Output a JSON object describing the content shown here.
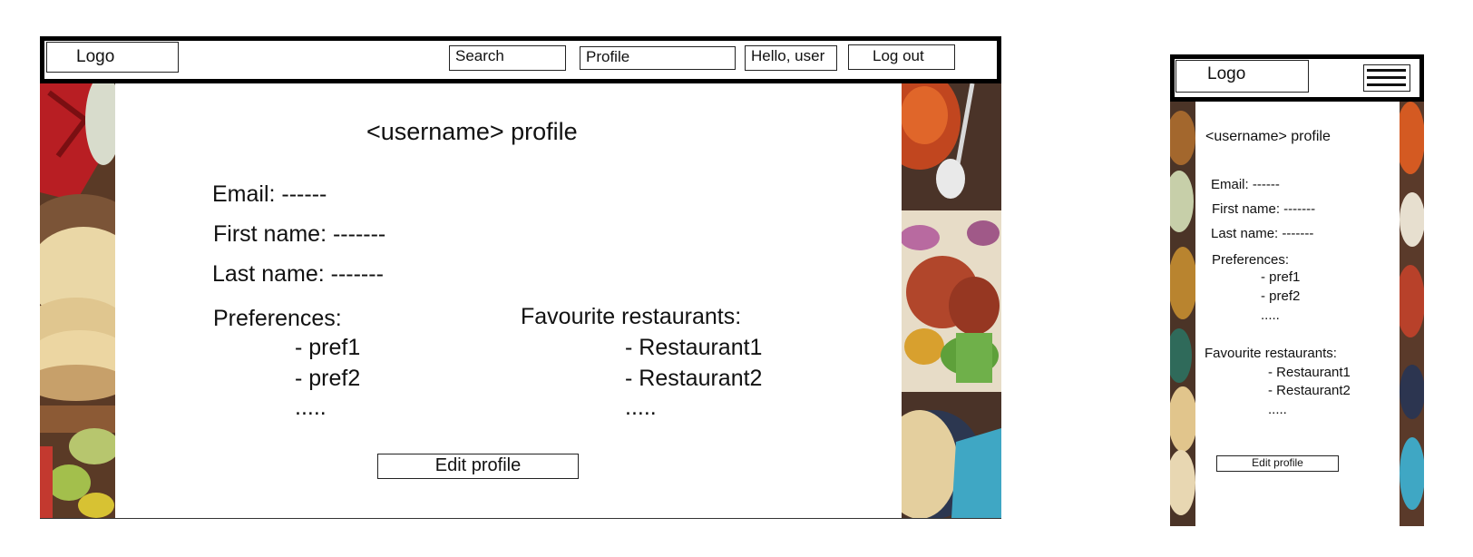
{
  "desktop": {
    "nav": {
      "logo": "Logo",
      "search": "Search",
      "profile": "Profile",
      "greeting": "Hello, user",
      "logout": "Log out"
    },
    "title": "<username> profile",
    "email": "Email: ------",
    "first_name": "First name: -------",
    "last_name": "Last name: -------",
    "preferences": {
      "label": "Preferences:",
      "items": [
        "- pref1",
        "- pref2",
        "....."
      ]
    },
    "favourites": {
      "label": "Favourite restaurants:",
      "items": [
        "- Restaurant1",
        "- Restaurant2",
        "....."
      ]
    },
    "edit_button": "Edit profile"
  },
  "mobile": {
    "nav": {
      "logo": "Logo",
      "menu_icon": "hamburger-menu-icon"
    },
    "title": "<username> profile",
    "email": "Email: ------",
    "first_name": "First name: -------",
    "last_name": "Last name: -------",
    "preferences": {
      "label": "Preferences:",
      "items": [
        "- pref1",
        "- pref2",
        "....."
      ]
    },
    "favourites": {
      "label": "Favourite restaurants:",
      "items": [
        "- Restaurant1",
        "- Restaurant2",
        "....."
      ]
    },
    "edit_button": "Edit profile"
  }
}
